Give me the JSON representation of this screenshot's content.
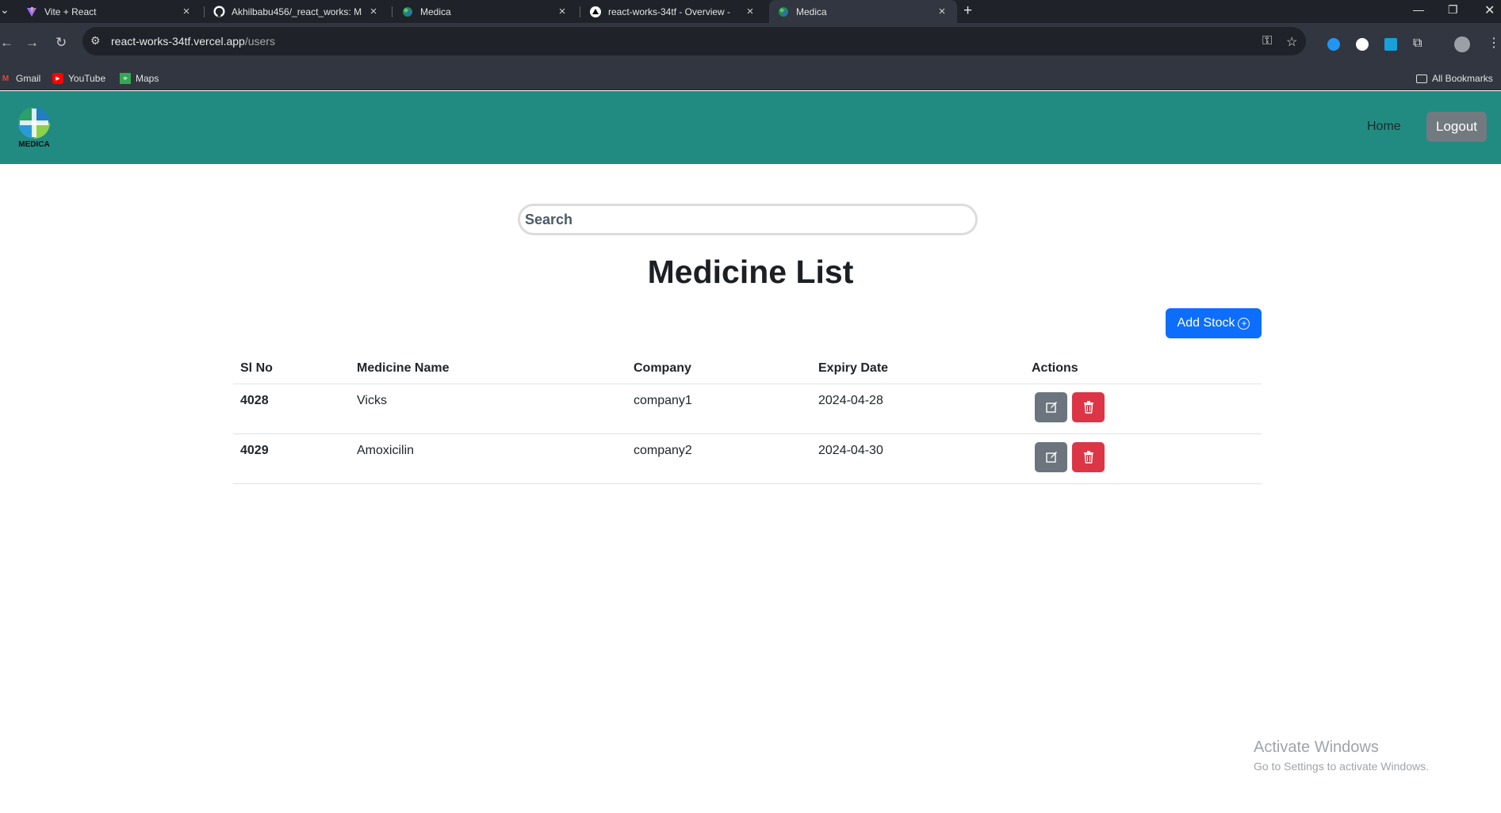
{
  "browser": {
    "tabs": [
      {
        "title": "Vite + React",
        "icon": "vite-icon"
      },
      {
        "title": "Akhilbabu456/_react_works: M",
        "icon": "github-icon"
      },
      {
        "title": "Medica",
        "icon": "medica-icon"
      },
      {
        "title": "react-works-34tf - Overview -",
        "icon": "vercel-icon"
      },
      {
        "title": "Medica",
        "icon": "medica-icon",
        "active": true
      }
    ],
    "url_host": "react-works-34tf.vercel.app",
    "url_path": "/users",
    "bookmarks": [
      {
        "label": "Gmail",
        "icon": "gmail-icon"
      },
      {
        "label": "YouTube",
        "icon": "youtube-icon"
      },
      {
        "label": "Maps",
        "icon": "maps-icon"
      }
    ],
    "all_bookmarks": "All Bookmarks"
  },
  "app": {
    "logo_text": "MEDICA",
    "nav": {
      "home": "Home",
      "logout": "Logout"
    },
    "search_placeholder": "Search",
    "title": "Medicine List",
    "add_stock": "Add Stock",
    "table": {
      "headers": [
        "Sl No",
        "Medicine Name",
        "Company",
        "Expiry Date",
        "Actions"
      ],
      "rows": [
        {
          "id": "4028",
          "name": "Vicks",
          "company": "company1",
          "expiry": "2024-04-28"
        },
        {
          "id": "4029",
          "name": "Amoxicilin",
          "company": "company2",
          "expiry": "2024-04-30"
        }
      ]
    },
    "colors": {
      "navbar": "#218b82",
      "primary": "#0d6efd",
      "danger": "#dc3545",
      "secondary": "#6c757d"
    }
  },
  "os_watermark": {
    "line1": "Activate Windows",
    "line2": "Go to Settings to activate Windows."
  }
}
